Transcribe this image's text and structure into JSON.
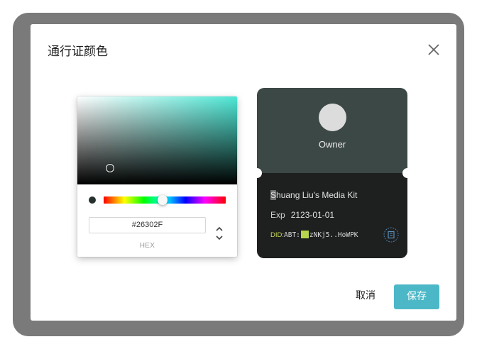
{
  "dialog": {
    "title": "通行证颜色",
    "close_icon": "close-icon"
  },
  "picker": {
    "hue_color": "#4ee8d6",
    "selected_color": "#26302F",
    "hex_value": "#26302F",
    "mode_label": "HEX",
    "toggle_icon": "chevron-up-down-icon"
  },
  "pass": {
    "top_color": "#3c4846",
    "bottom_color": "#1e1f1f",
    "role": "Owner",
    "kit_name_first": "S",
    "kit_name_rest": "huang Liu's Media Kit",
    "exp_label": "Exp",
    "exp_date": "2123-01-01",
    "did_prefix": "DID:",
    "did_start": "ABT:",
    "did_end": "zNKj5..HoWPK",
    "seal_icon": "seal-icon"
  },
  "footer": {
    "cancel_label": "取消",
    "save_label": "保存",
    "accent": "#4cb8c7"
  }
}
